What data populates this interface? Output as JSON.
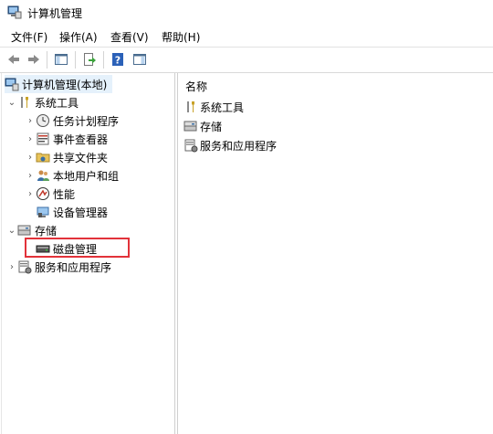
{
  "window": {
    "title": "计算机管理",
    "icon": "computer-management-icon"
  },
  "menu": [
    {
      "label": "文件(F)"
    },
    {
      "label": "操作(A)"
    },
    {
      "label": "查看(V)"
    },
    {
      "label": "帮助(H)"
    }
  ],
  "toolbar": {
    "buttons": [
      "back-arrow-icon",
      "forward-arrow-icon",
      "show-tree-icon",
      "export-list-icon",
      "help-icon",
      "properties-pane-icon"
    ]
  },
  "tree": {
    "root": "计算机管理(本地)",
    "system_tools": "系统工具",
    "task_scheduler": "任务计划程序",
    "event_viewer": "事件查看器",
    "shared_folders": "共享文件夹",
    "local_users": "本地用户和组",
    "performance": "性能",
    "device_manager": "设备管理器",
    "storage": "存储",
    "disk_management": "磁盘管理",
    "services_apps": "服务和应用程序"
  },
  "list": {
    "column_name": "名称",
    "items": [
      {
        "label": "系统工具",
        "icon": "tools-icon"
      },
      {
        "label": "存储",
        "icon": "storage-icon"
      },
      {
        "label": "服务和应用程序",
        "icon": "services-icon"
      }
    ]
  },
  "colors": {
    "selection_box": "#e2323a",
    "root_highlight": "#e5f1fb"
  }
}
